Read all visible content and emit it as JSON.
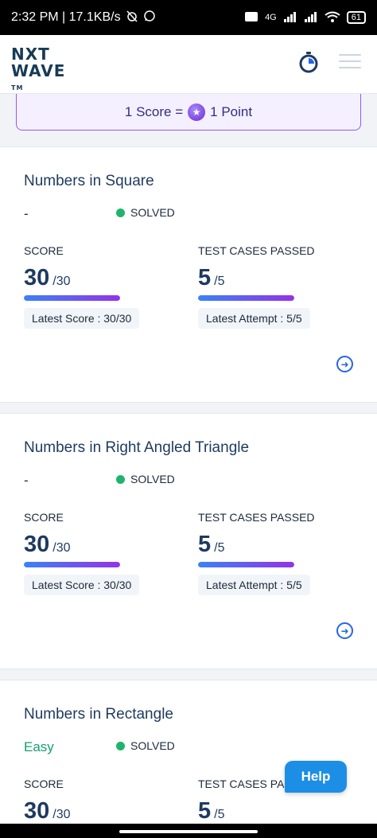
{
  "status_bar": {
    "time_speed": "2:32 PM | 17.1KB/s",
    "network": "4G",
    "battery": "61"
  },
  "header": {
    "logo_line1": "NXT",
    "logo_line2": "WAVE",
    "logo_tm": "TM"
  },
  "banner": {
    "left": "1 Score =",
    "right": "1 Point"
  },
  "labels": {
    "score": "SCORE",
    "test_cases": "TEST CASES PASSED",
    "solved": "SOLVED"
  },
  "problems": [
    {
      "title": "Numbers in Square",
      "difficulty": "-",
      "score": "30",
      "score_total": "/30",
      "score_fraction": 1.0,
      "tests": "5",
      "tests_total": "/5",
      "tests_fraction": 1.0,
      "latest_score": "Latest Score : 30/30",
      "latest_attempt": "Latest Attempt : 5/5"
    },
    {
      "title": "Numbers in Right Angled Triangle",
      "difficulty": "-",
      "score": "30",
      "score_total": "/30",
      "score_fraction": 1.0,
      "tests": "5",
      "tests_total": "/5",
      "tests_fraction": 1.0,
      "latest_score": "Latest Score : 30/30",
      "latest_attempt": "Latest Attempt : 5/5"
    },
    {
      "title": "Numbers in Rectangle",
      "difficulty": "Easy",
      "score": "30",
      "score_total": "/30",
      "tests": "5",
      "tests_total": "/5"
    }
  ],
  "help": "Help",
  "colors": {
    "solved_dot": "#1db46c",
    "accent_blue": "#2563eb",
    "easy": "#14a06e",
    "banner_border": "#8b5cf6"
  }
}
